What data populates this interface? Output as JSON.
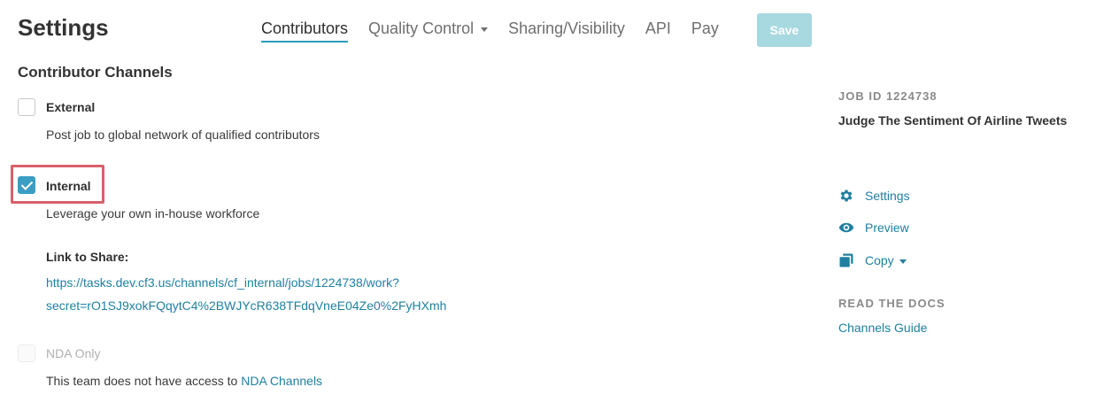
{
  "header": {
    "title": "Settings",
    "tabs": [
      {
        "label": "Contributors"
      },
      {
        "label": "Quality Control"
      },
      {
        "label": "Sharing/Visibility"
      },
      {
        "label": "API"
      },
      {
        "label": "Pay"
      }
    ],
    "save_label": "Save"
  },
  "section": {
    "title": "Contributor Channels"
  },
  "channels": {
    "external": {
      "label": "External",
      "description": "Post job to global network of qualified contributors",
      "checked": false
    },
    "internal": {
      "label": "Internal",
      "description": "Leverage your own in-house workforce",
      "checked": true,
      "link_label": "Link to Share:",
      "link_line1": "https://tasks.dev.cf3.us/channels/cf_internal/jobs/1224738/work?",
      "link_line2": "secret=rO1SJ9xokFQqytC4%2BWJYcR638TFdqVneE04Ze0%2FyHXmh"
    },
    "nda": {
      "label": "NDA Only",
      "description_prefix": "This team does not have access to",
      "description_link": "NDA Channels",
      "checked": false
    }
  },
  "sidebar": {
    "job_id": "JOB ID 1224738",
    "job_title": "Judge The Sentiment Of Airline Tweets",
    "actions": [
      {
        "label": "Settings",
        "icon": "gear-icon"
      },
      {
        "label": "Preview",
        "icon": "eye-icon"
      },
      {
        "label": "Copy",
        "icon": "copy-icon"
      }
    ],
    "docs_title": "READ THE DOCS",
    "docs_link": "Channels Guide"
  },
  "colors": {
    "accent": "#3a9ec4",
    "link": "#1f7fa0",
    "highlight": "#d9606a",
    "save_button": "#a8d8e0"
  }
}
